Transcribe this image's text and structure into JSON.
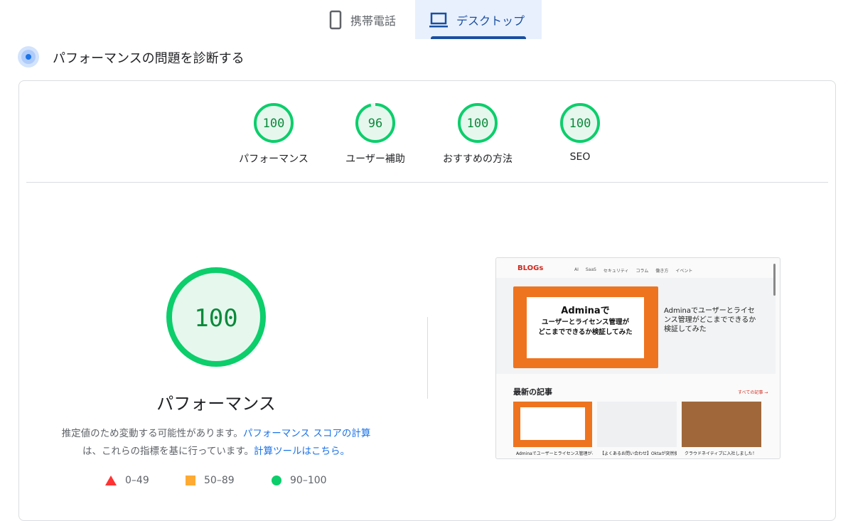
{
  "tabs": [
    {
      "label": "携帯電話",
      "icon": "phone-icon"
    },
    {
      "label": "デスクトップ",
      "icon": "laptop-icon",
      "active": true
    }
  ],
  "section_title": "パフォーマンスの問題を診断する",
  "scores": [
    {
      "label": "パフォーマンス",
      "value": 100
    },
    {
      "label": "ユーザー補助",
      "value": 96
    },
    {
      "label": "おすすめの方法",
      "value": 100
    },
    {
      "label": "SEO",
      "value": 100
    }
  ],
  "main": {
    "score": 100,
    "title": "パフォーマンス",
    "desc1": "推定値のため変動する可能性があります。",
    "link1": "パフォーマンス スコアの計算",
    "desc2": "は、これらの指標を基に行っています。",
    "link2": "計算ツールはこちら。"
  },
  "legend": [
    {
      "range": "0–49",
      "color": "#ff3333"
    },
    {
      "range": "50–89",
      "color": "#ffaa33"
    },
    {
      "range": "90–100",
      "color": "#0cce6b"
    }
  ],
  "screenshot": {
    "logo": "BLOGs",
    "nav": [
      "AI",
      "SaaS",
      "セキュリティ",
      "コラム",
      "働き方",
      "イベント"
    ],
    "hero_line1": "Adminaで",
    "hero_line2": "ユーザーとライセンス管理が",
    "hero_line3": "どこまでできるか検証してみた",
    "article_title": "Adminaでユーザーとライセンス管理がどこまでできるか検証してみた",
    "latest": "最新の記事",
    "all": "すべての記事 →",
    "cards": [
      "Adminaでユーザーとライセンス管理がどこま",
      "【よくあるお問い合わせ】Oktaが突然使えなく",
      "クラウドネイティブに入社しました！"
    ]
  }
}
